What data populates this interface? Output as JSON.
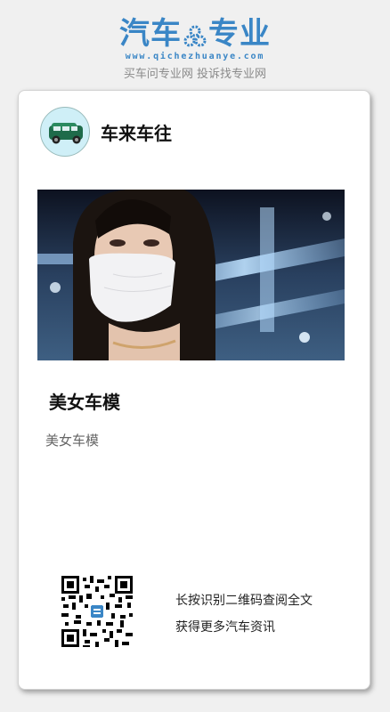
{
  "header": {
    "logo_left": "汽车",
    "logo_right": "专业",
    "domain": "www.qichezhuanye.com",
    "slogan": "买车问专业网 投诉找专业网",
    "brand_color": "#3a86c6"
  },
  "card": {
    "account_name": "车来车往",
    "avatar_icon": "green-car-icon",
    "photo_icon": "car-model-photo",
    "article_title": "美女车模",
    "article_description": "美女车模",
    "qr_line1": "长按识别二维码查阅全文",
    "qr_line2": "获得更多汽车资讯"
  }
}
